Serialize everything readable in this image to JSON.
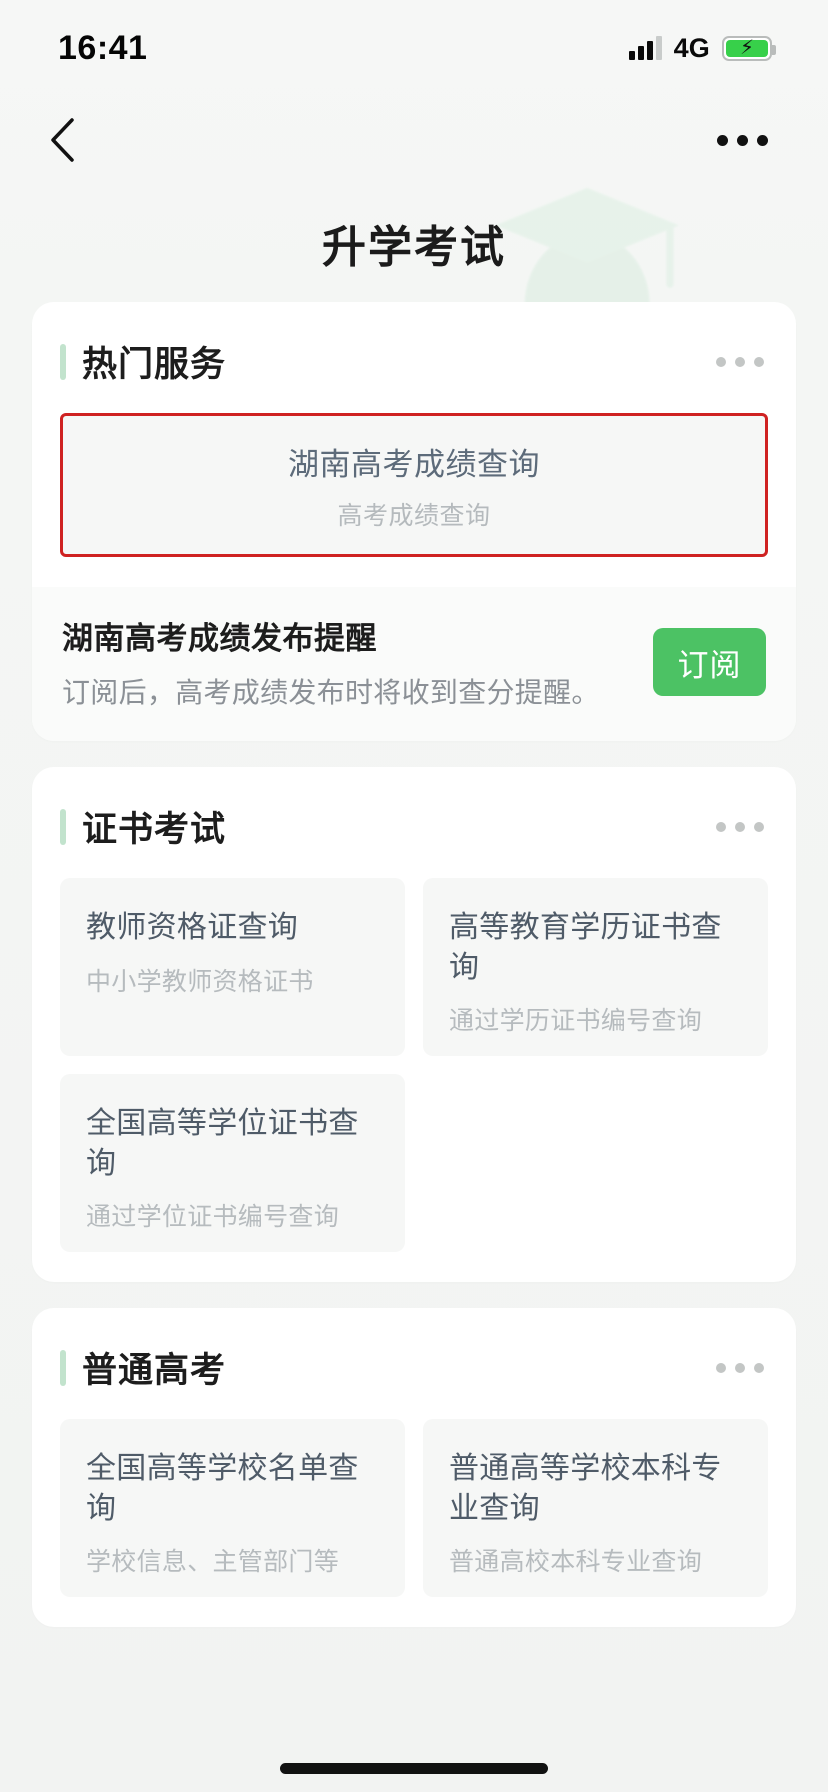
{
  "statusbar": {
    "time": "16:41",
    "network": "4G",
    "signal_icon": "signal-bars-icon",
    "battery_icon": "battery-charging-icon"
  },
  "navbar": {
    "back_icon": "chevron-left-icon",
    "more_icon": "more-horizontal-icon"
  },
  "header": {
    "title": "升学考试",
    "decoration_icon": "graduation-cap-watermark-icon"
  },
  "sections": [
    {
      "title": "热门服务",
      "more_icon": "more-horizontal-icon",
      "highlighted": {
        "title": "湖南高考成绩查询",
        "subtitle": "高考成绩查询",
        "highlight_color": "#cf2222"
      },
      "subscribe": {
        "title": "湖南高考成绩发布提醒",
        "description": "订阅后，高考成绩发布时将收到查分提醒。",
        "button_label": "订阅",
        "button_color": "#4cc264"
      }
    },
    {
      "title": "证书考试",
      "more_icon": "more-horizontal-icon",
      "items": [
        {
          "title": "教师资格证查询",
          "subtitle": "中小学教师资格证书"
        },
        {
          "title": "高等教育学历证书查询",
          "subtitle": "通过学历证书编号查询"
        },
        {
          "title": "全国高等学位证书查询",
          "subtitle": "通过学位证书编号查询"
        }
      ]
    },
    {
      "title": "普通高考",
      "more_icon": "more-horizontal-icon",
      "items": [
        {
          "title": "全国高等学校名单查询",
          "subtitle": "学校信息、主管部门等"
        },
        {
          "title": "普通高等学校本科专业查询",
          "subtitle": "普通高校本科专业查询"
        }
      ]
    }
  ]
}
